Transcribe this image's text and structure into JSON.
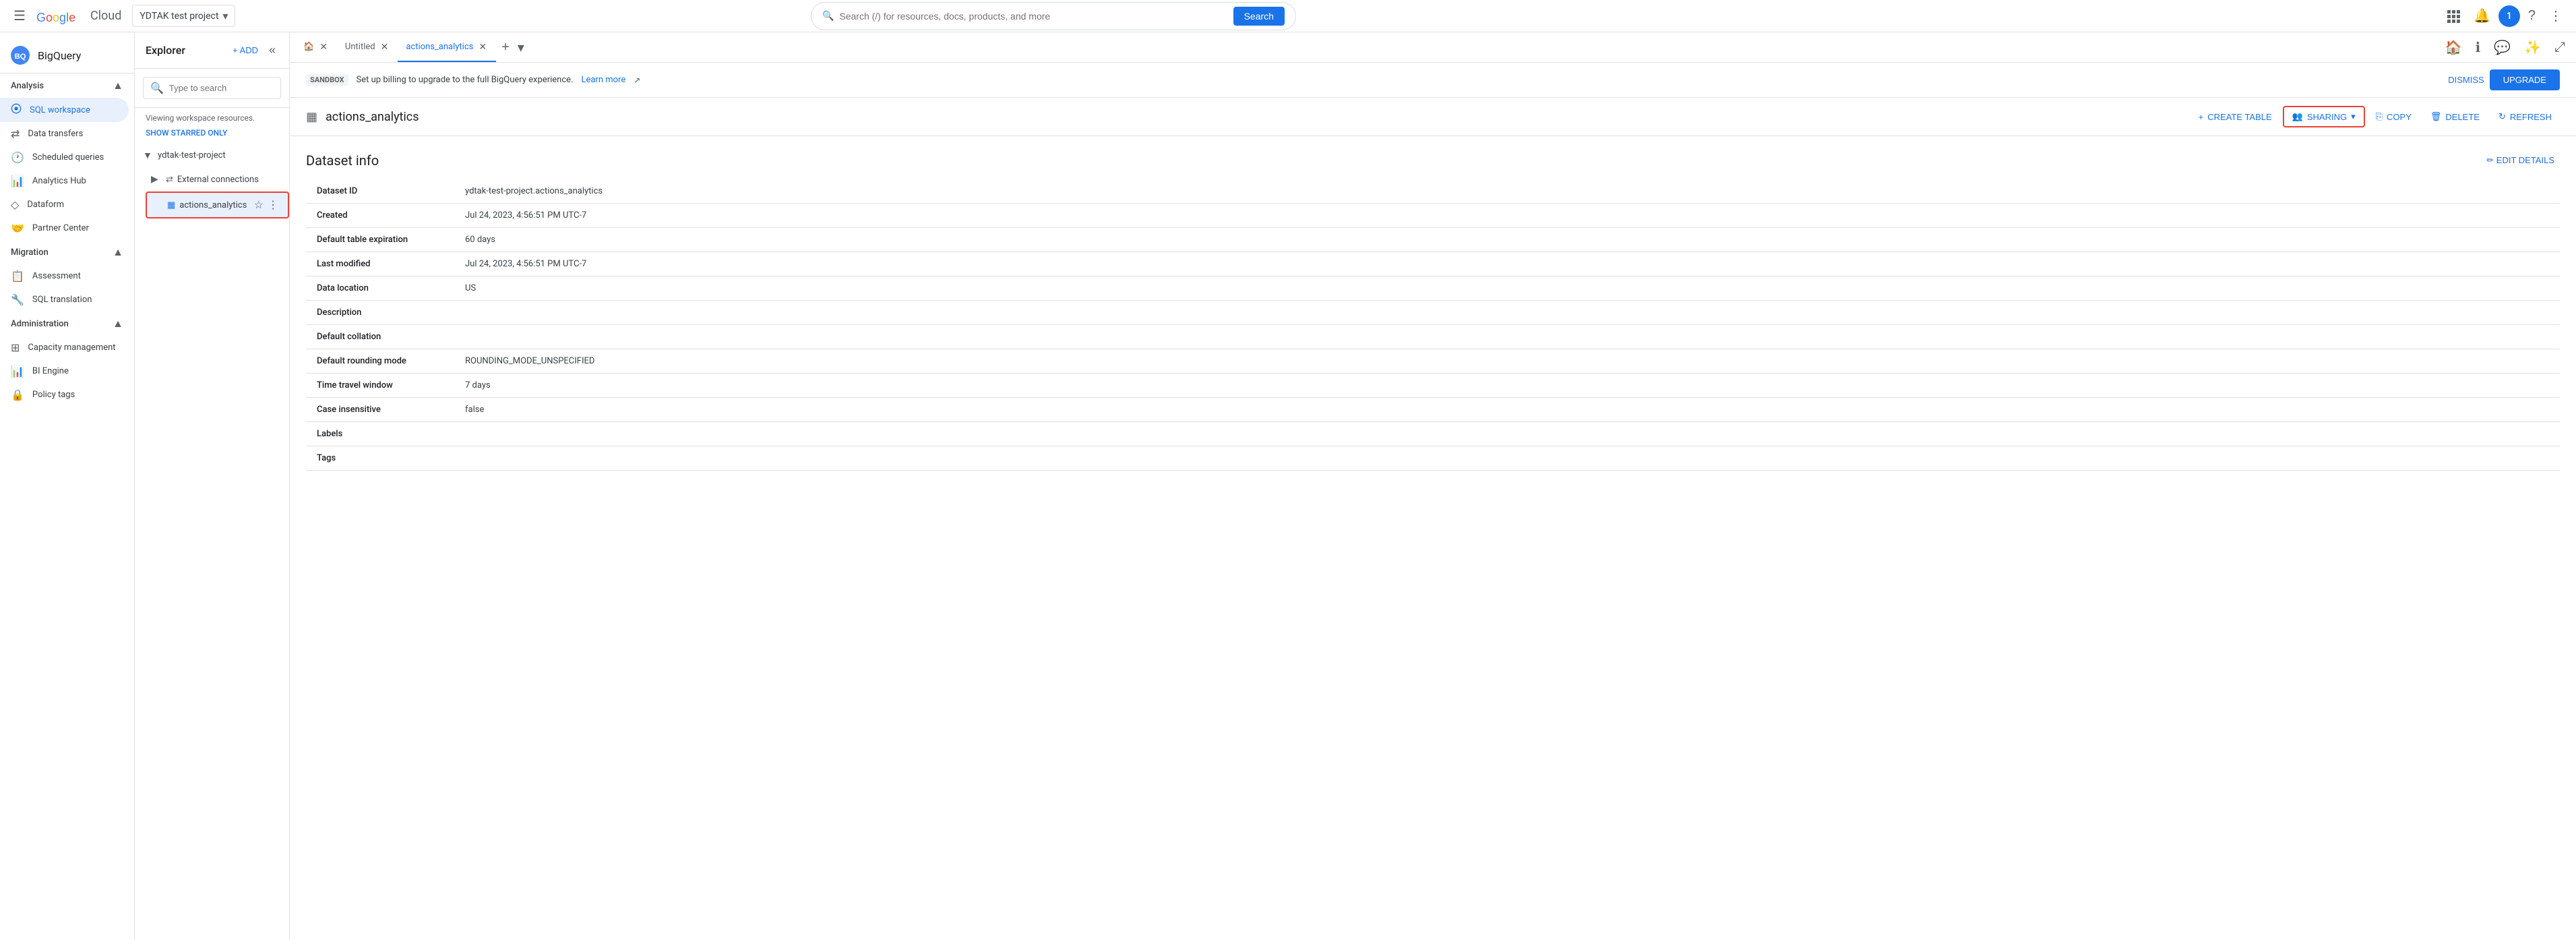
{
  "topNav": {
    "hamburger": "☰",
    "logoGoogle": "Google",
    "logoCloud": "Cloud",
    "projectName": "YDTAK test project",
    "searchPlaceholder": "Search (/) for resources, docs, products, and more",
    "searchBtnLabel": "Search",
    "icons": {
      "apps": "⋮⋮⋮",
      "notifications": "🔔",
      "help": "?",
      "more": "⋮"
    },
    "avatarText": "1"
  },
  "sidebar": {
    "bqTitle": "BigQuery",
    "analysisLabel": "Analysis",
    "items": [
      {
        "id": "sql-workspace",
        "label": "SQL workspace",
        "icon": "⬡",
        "active": true
      },
      {
        "id": "data-transfers",
        "label": "Data transfers",
        "icon": "⇄"
      },
      {
        "id": "scheduled-queries",
        "label": "Scheduled queries",
        "icon": "🕐"
      },
      {
        "id": "analytics-hub",
        "label": "Analytics Hub",
        "icon": "📊"
      },
      {
        "id": "dataform",
        "label": "Dataform",
        "icon": "◇"
      },
      {
        "id": "partner-center",
        "label": "Partner Center",
        "icon": "🤝"
      }
    ],
    "migrationLabel": "Migration",
    "migrationItems": [
      {
        "id": "assessment",
        "label": "Assessment",
        "icon": "📋"
      },
      {
        "id": "sql-translation",
        "label": "SQL translation",
        "icon": "🔧"
      }
    ],
    "administrationLabel": "Administration",
    "adminItems": [
      {
        "id": "capacity-management",
        "label": "Capacity management",
        "icon": "⊞"
      },
      {
        "id": "bi-engine",
        "label": "BI Engine",
        "icon": "📊"
      },
      {
        "id": "policy-tags",
        "label": "Policy tags",
        "icon": "🔒"
      }
    ]
  },
  "explorer": {
    "title": "Explorer",
    "addLabel": "+ ADD",
    "searchPlaceholder": "Type to search",
    "workspaceLabel": "Viewing workspace resources.",
    "showStarredLabel": "SHOW STARRED ONLY",
    "projectName": "ydtak-test-project",
    "externalConnections": "External connections",
    "actionsDataset": "actions_analytics"
  },
  "tabs": [
    {
      "id": "home",
      "icon": "🏠",
      "label": "",
      "closeable": false
    },
    {
      "id": "untitled",
      "label": "Untitled",
      "closeable": true
    },
    {
      "id": "actions-analytics",
      "label": "actions_analytics",
      "closeable": true,
      "active": true
    }
  ],
  "sandbox": {
    "badge": "SANDBOX",
    "message": "Set up billing to upgrade to the full BigQuery experience.",
    "linkText": "Learn more",
    "dismissLabel": "DISMISS",
    "upgradeLabel": "UPGRADE"
  },
  "dataset": {
    "icon": "▦",
    "name": "actions_analytics",
    "toolbar": {
      "createTableLabel": "CREATE TABLE",
      "sharingLabel": "SHARING",
      "copyLabel": "COPY",
      "deleteLabel": "DELETE",
      "refreshLabel": "REFRESH"
    },
    "infoTitle": "Dataset info",
    "editDetailsLabel": "✏ EDIT DETAILS",
    "fields": [
      {
        "key": "Dataset ID",
        "value": "ydtak-test-project.actions_analytics"
      },
      {
        "key": "Created",
        "value": "Jul 24, 2023, 4:56:51 PM UTC-7"
      },
      {
        "key": "Default table expiration",
        "value": "60 days"
      },
      {
        "key": "Last modified",
        "value": "Jul 24, 2023, 4:56:51 PM UTC-7"
      },
      {
        "key": "Data location",
        "value": "US"
      },
      {
        "key": "Description",
        "value": ""
      },
      {
        "key": "Default collation",
        "value": ""
      },
      {
        "key": "Default rounding mode",
        "value": "ROUNDING_MODE_UNSPECIFIED"
      },
      {
        "key": "Time travel window",
        "value": "7 days"
      },
      {
        "key": "Case insensitive",
        "value": "false"
      },
      {
        "key": "Labels",
        "value": ""
      },
      {
        "key": "Tags",
        "value": ""
      }
    ]
  }
}
